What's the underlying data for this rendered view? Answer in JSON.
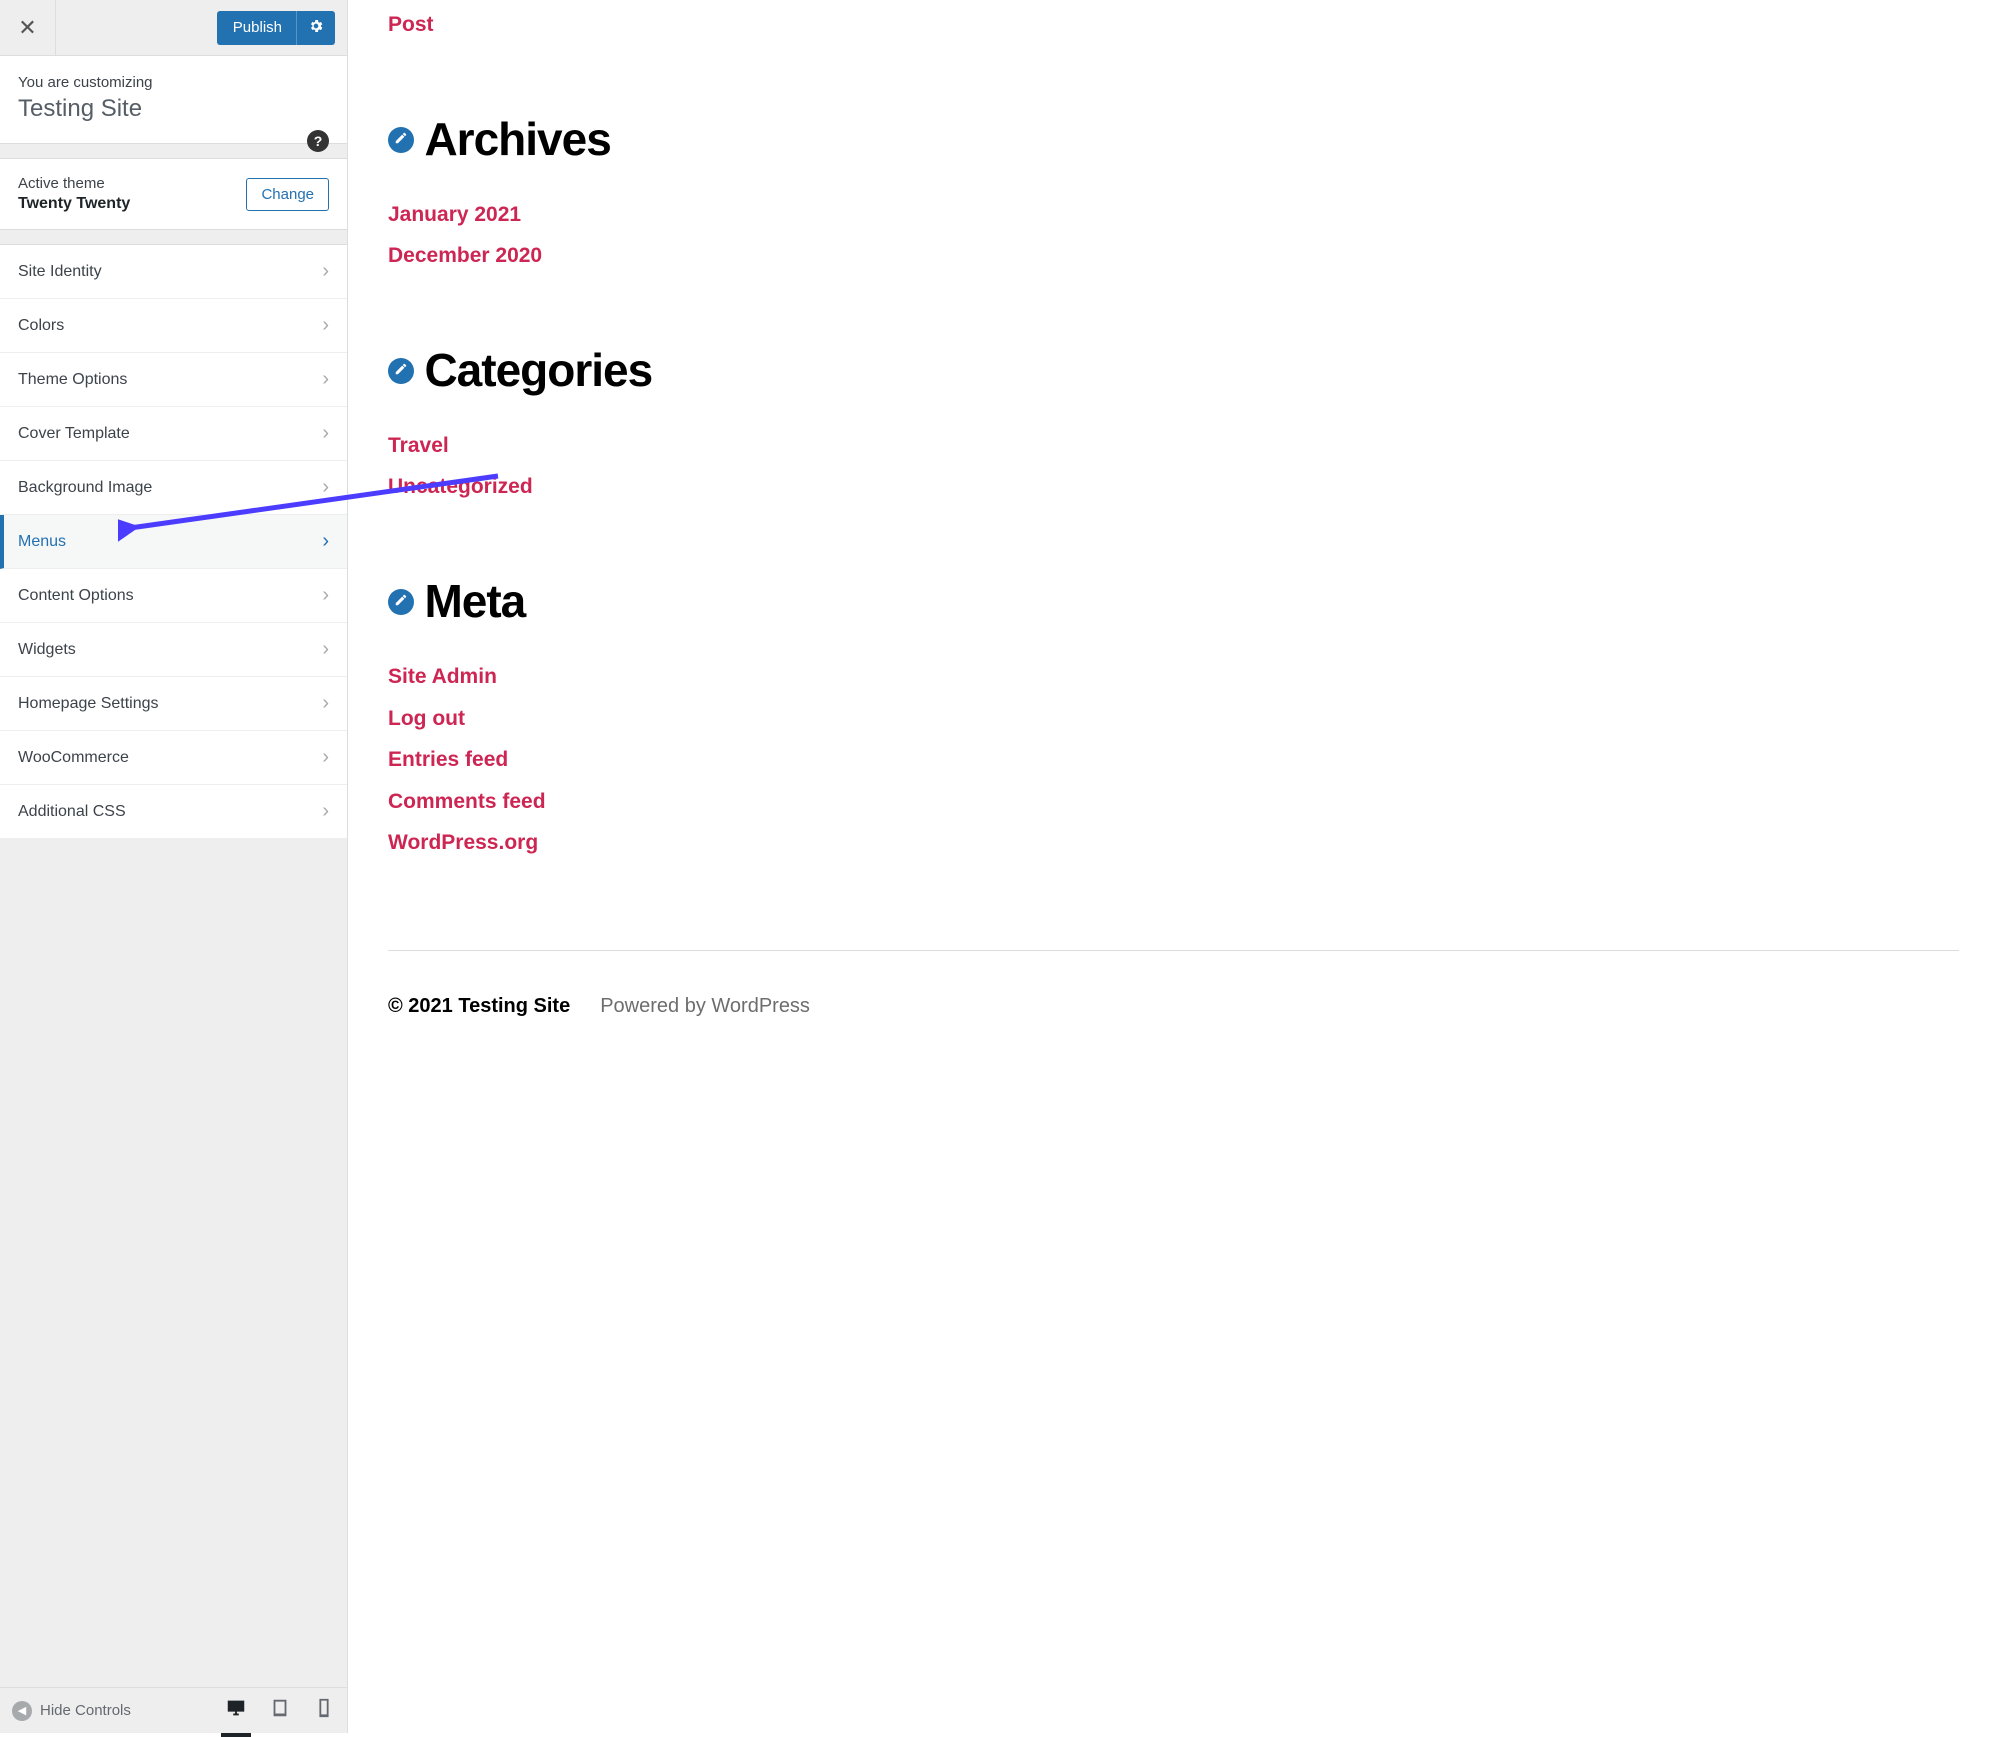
{
  "header": {
    "publish_label": "Publish",
    "customizing_label": "You are customizing",
    "site_title": "Testing Site",
    "help_char": "?"
  },
  "theme": {
    "label": "Active theme",
    "name": "Twenty Twenty",
    "change_label": "Change"
  },
  "sections": [
    {
      "label": "Site Identity",
      "id": "site-identity"
    },
    {
      "label": "Colors",
      "id": "colors"
    },
    {
      "label": "Theme Options",
      "id": "theme-options"
    },
    {
      "label": "Cover Template",
      "id": "cover-template"
    },
    {
      "label": "Background Image",
      "id": "background-image"
    },
    {
      "label": "Menus",
      "id": "menus",
      "active": true
    },
    {
      "label": "Content Options",
      "id": "content-options"
    },
    {
      "label": "Widgets",
      "id": "widgets"
    },
    {
      "label": "Homepage Settings",
      "id": "homepage-settings"
    },
    {
      "label": "WooCommerce",
      "id": "woocommerce"
    },
    {
      "label": "Additional CSS",
      "id": "additional-css"
    }
  ],
  "footer_controls": {
    "hide_label": "Hide Controls"
  },
  "preview": {
    "top_link": "Post",
    "archives": {
      "title": "Archives",
      "items": [
        "January 2021",
        "December 2020"
      ]
    },
    "categories": {
      "title": "Categories",
      "items": [
        "Travel",
        "Uncategorized"
      ]
    },
    "meta": {
      "title": "Meta",
      "items": [
        "Site Admin",
        "Log out",
        "Entries feed",
        "Comments feed",
        "WordPress.org"
      ]
    },
    "footer_copy": "© 2021 Testing Site",
    "footer_powered": "Powered by WordPress"
  }
}
